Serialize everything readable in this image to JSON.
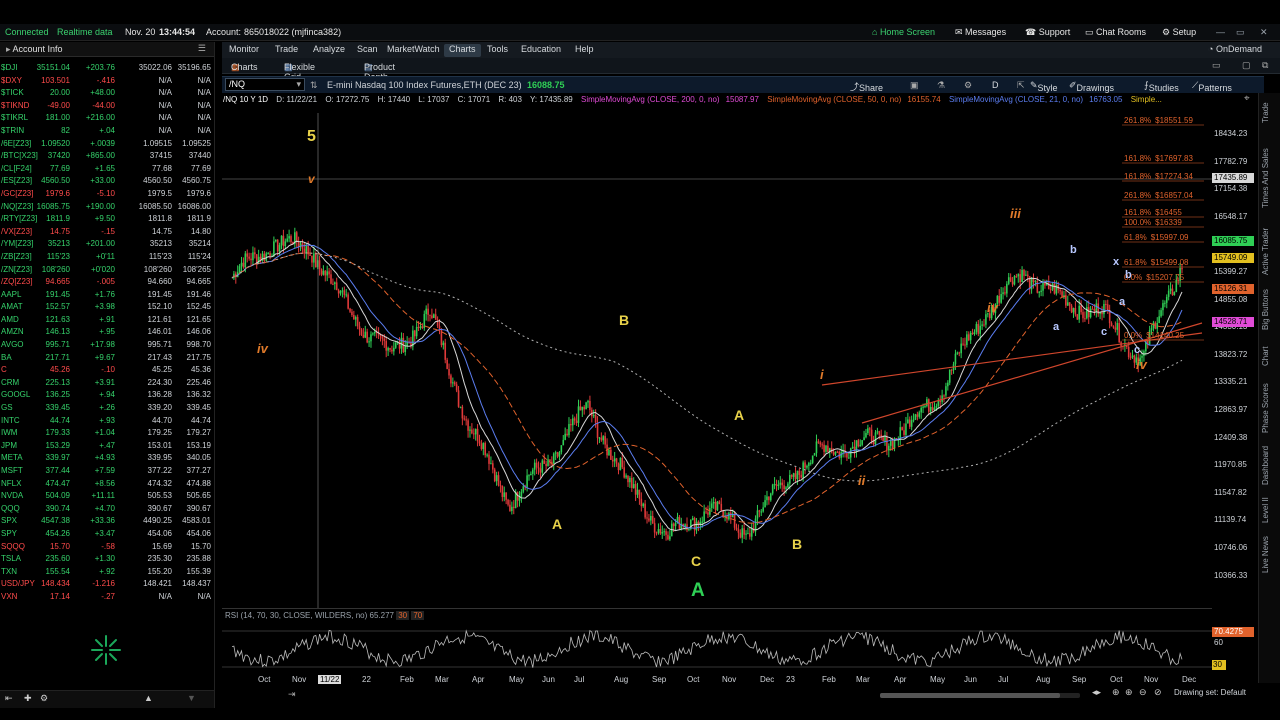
{
  "topbar": {
    "connection": "Connected",
    "data_mode": "Realtime data",
    "date": "Nov. 20",
    "time": "13:44:54",
    "account_label": "Account:",
    "account": "865018022 (mjfinca382)",
    "home": "Home Screen",
    "messages": "Messages",
    "support": "Support",
    "chat": "Chat Rooms",
    "setup": "Setup"
  },
  "sidebar": {
    "header": "Account Info",
    "watchlist": [
      {
        "sym": "$DJI",
        "last": "35151.04",
        "chg": "+203.76",
        "bid": "35022.06",
        "ask": "35196.65",
        "dir": "up"
      },
      {
        "sym": "$DXY",
        "last": "103.501",
        "chg": "-.416",
        "bid": "N/A",
        "ask": "N/A",
        "dir": "dn"
      },
      {
        "sym": "$TICK",
        "last": "20.00",
        "chg": "+48.00",
        "bid": "N/A",
        "ask": "N/A",
        "dir": "up"
      },
      {
        "sym": "$TIKND",
        "last": "-49.00",
        "chg": "-44.00",
        "bid": "N/A",
        "ask": "N/A",
        "dir": "dn"
      },
      {
        "sym": "$TIKRL",
        "last": "181.00",
        "chg": "+216.00",
        "bid": "N/A",
        "ask": "N/A",
        "dir": "up"
      },
      {
        "sym": "$TRIN",
        "last": "82",
        "chg": "+.04",
        "bid": "N/A",
        "ask": "N/A",
        "dir": "up"
      },
      {
        "sym": "/6E[Z23]",
        "last": "1.09520",
        "chg": "+.0039",
        "bid": "1.09515",
        "ask": "1.09525",
        "dir": "up"
      },
      {
        "sym": "/BTC[X23]",
        "last": "37420",
        "chg": "+865.00",
        "bid": "37415",
        "ask": "37440",
        "dir": "up"
      },
      {
        "sym": "/CL[F24]",
        "last": "77.69",
        "chg": "+1.65",
        "bid": "77.68",
        "ask": "77.69",
        "dir": "up"
      },
      {
        "sym": "/ES[Z23]",
        "last": "4560.50",
        "chg": "+33.00",
        "bid": "4560.50",
        "ask": "4560.75",
        "dir": "up"
      },
      {
        "sym": "/GC[Z23]",
        "last": "1979.6",
        "chg": "-5.10",
        "bid": "1979.5",
        "ask": "1979.6",
        "dir": "dn"
      },
      {
        "sym": "/NQ[Z23]",
        "last": "16085.75",
        "chg": "+190.00",
        "bid": "16085.50",
        "ask": "16086.00",
        "dir": "up"
      },
      {
        "sym": "/RTY[Z23]",
        "last": "1811.9",
        "chg": "+9.50",
        "bid": "1811.8",
        "ask": "1811.9",
        "dir": "up"
      },
      {
        "sym": "/VX[Z23]",
        "last": "14.75",
        "chg": "-.15",
        "bid": "14.75",
        "ask": "14.80",
        "dir": "dn"
      },
      {
        "sym": "/YM[Z23]",
        "last": "35213",
        "chg": "+201.00",
        "bid": "35213",
        "ask": "35214",
        "dir": "up"
      },
      {
        "sym": "/ZB[Z23]",
        "last": "115'23",
        "chg": "+0'11",
        "bid": "115'23",
        "ask": "115'24",
        "dir": "up"
      },
      {
        "sym": "/ZN[Z23]",
        "last": "108'260",
        "chg": "+0'020",
        "bid": "108'260",
        "ask": "108'265",
        "dir": "up"
      },
      {
        "sym": "/ZQ[Z23]",
        "last": "94.665",
        "chg": "-.005",
        "bid": "94.660",
        "ask": "94.665",
        "dir": "dn"
      },
      {
        "sym": "AAPL",
        "last": "191.45",
        "chg": "+1.76",
        "bid": "191.45",
        "ask": "191.46",
        "dir": "up"
      },
      {
        "sym": "AMAT",
        "last": "152.57",
        "chg": "+3.98",
        "bid": "152.10",
        "ask": "152.45",
        "dir": "up"
      },
      {
        "sym": "AMD",
        "last": "121.63",
        "chg": "+.91",
        "bid": "121.61",
        "ask": "121.65",
        "dir": "up"
      },
      {
        "sym": "AMZN",
        "last": "146.13",
        "chg": "+.95",
        "bid": "146.01",
        "ask": "146.06",
        "dir": "up"
      },
      {
        "sym": "AVGO",
        "last": "995.71",
        "chg": "+17.98",
        "bid": "995.71",
        "ask": "998.70",
        "dir": "up"
      },
      {
        "sym": "BA",
        "last": "217.71",
        "chg": "+9.67",
        "bid": "217.43",
        "ask": "217.75",
        "dir": "up"
      },
      {
        "sym": "C",
        "last": "45.26",
        "chg": "-.10",
        "bid": "45.25",
        "ask": "45.36",
        "dir": "dn"
      },
      {
        "sym": "CRM",
        "last": "225.13",
        "chg": "+3.91",
        "bid": "224.30",
        "ask": "225.46",
        "dir": "up"
      },
      {
        "sym": "GOOGL",
        "last": "136.25",
        "chg": "+.94",
        "bid": "136.28",
        "ask": "136.32",
        "dir": "up"
      },
      {
        "sym": "GS",
        "last": "339.45",
        "chg": "+.26",
        "bid": "339.20",
        "ask": "339.45",
        "dir": "up"
      },
      {
        "sym": "INTC",
        "last": "44.74",
        "chg": "+.93",
        "bid": "44.70",
        "ask": "44.74",
        "dir": "up"
      },
      {
        "sym": "IWM",
        "last": "179.33",
        "chg": "+1.04",
        "bid": "179.25",
        "ask": "179.27",
        "dir": "up"
      },
      {
        "sym": "JPM",
        "last": "153.29",
        "chg": "+.47",
        "bid": "153.01",
        "ask": "153.19",
        "dir": "up"
      },
      {
        "sym": "META",
        "last": "339.97",
        "chg": "+4.93",
        "bid": "339.95",
        "ask": "340.05",
        "dir": "up"
      },
      {
        "sym": "MSFT",
        "last": "377.44",
        "chg": "+7.59",
        "bid": "377.22",
        "ask": "377.27",
        "dir": "up"
      },
      {
        "sym": "NFLX",
        "last": "474.47",
        "chg": "+8.56",
        "bid": "474.32",
        "ask": "474.88",
        "dir": "up"
      },
      {
        "sym": "NVDA",
        "last": "504.09",
        "chg": "+11.11",
        "bid": "505.53",
        "ask": "505.65",
        "dir": "up"
      },
      {
        "sym": "QQQ",
        "last": "390.74",
        "chg": "+4.70",
        "bid": "390.67",
        "ask": "390.67",
        "dir": "up"
      },
      {
        "sym": "SPX",
        "last": "4547.38",
        "chg": "+33.36",
        "bid": "4490.25",
        "ask": "4583.01",
        "dir": "up"
      },
      {
        "sym": "SPY",
        "last": "454.26",
        "chg": "+3.47",
        "bid": "454.06",
        "ask": "454.06",
        "dir": "up"
      },
      {
        "sym": "SQQQ",
        "last": "15.70",
        "chg": "-.58",
        "bid": "15.69",
        "ask": "15.70",
        "dir": "dn"
      },
      {
        "sym": "TSLA",
        "last": "235.60",
        "chg": "+1.30",
        "bid": "235.30",
        "ask": "235.88",
        "dir": "up"
      },
      {
        "sym": "TXN",
        "last": "155.54",
        "chg": "+.92",
        "bid": "155.20",
        "ask": "155.39",
        "dir": "up"
      },
      {
        "sym": "USD/JPY",
        "last": "148.434",
        "chg": "-1.216",
        "bid": "148.421",
        "ask": "148.437",
        "dir": "dn"
      },
      {
        "sym": "VXN",
        "last": "17.14",
        "chg": "-.27",
        "bid": "N/A",
        "ask": "N/A",
        "dir": "dn"
      }
    ]
  },
  "menu": [
    "Monitor",
    "Trade",
    "Analyze",
    "Scan",
    "MarketWatch",
    "Charts",
    "Tools",
    "Education",
    "Help"
  ],
  "menu_active": "Charts",
  "ondemand": "OnDemand",
  "subtabs": {
    "charts": "Charts",
    "grid": "Flexible Grid",
    "depth": "Product Depth"
  },
  "toolbar": {
    "symbol": "/NQ",
    "description": "E-mini Nasdaq 100 Index Futures,ETH (DEC 23)",
    "price": "16088.75",
    "share": "Share",
    "period": "D",
    "style": "Style",
    "drawings": "Drawings",
    "studies": "Studies",
    "patterns": "Patterns"
  },
  "infobar": {
    "label": "/NQ 10 Y 1D",
    "d": "D: 11/22/21",
    "o": "O: 17272.75",
    "h": "H: 17440",
    "l": "L: 17037",
    "c": "C: 17071",
    "r": "R: 403",
    "y": "Y: 17435.89",
    "sma200": "SimpleMovingAvg (CLOSE, 200, 0, no)",
    "sma200v": "15087.97",
    "sma50": "SimpleMovingAvg (CLOSE, 50, 0, no)",
    "sma50v": "16155.74",
    "sma21": "SimpleMovingAvg (CLOSE, 21, 0, no)",
    "sma21v": "16763.05",
    "more": "Simple..."
  },
  "yaxis": [
    "18434.23",
    "17782.79",
    "17154.38",
    "16548.17",
    "15963.35",
    "15399.27",
    "14855.08",
    "14330.13",
    "13823.72",
    "13335.21",
    "12863.97",
    "12409.38",
    "11970.85",
    "11547.82",
    "11139.74",
    "10746.06",
    "10366.33"
  ],
  "ytags": [
    {
      "v": "17435.89",
      "c": "#d8d8d8"
    },
    {
      "v": "16085.75",
      "c": "#2fcf55"
    },
    {
      "v": "15749.09",
      "c": "#e3c020"
    },
    {
      "v": "15126.31",
      "c": "#e0622c"
    },
    {
      "v": "14528.71",
      "c": "#e04bd6"
    }
  ],
  "fib": [
    {
      "t": "261.8%",
      "v": "$18551.59"
    },
    {
      "t": "161.8%",
      "v": "$17697.83"
    },
    {
      "t": "161.8%",
      "v": "$17274.34"
    },
    {
      "t": "261.8%",
      "v": "$16857.04"
    },
    {
      "t": "161.8%",
      "v": "$16455"
    },
    {
      "t": "100.0%",
      "v": "$16339"
    },
    {
      "t": "61.8%",
      "v": "$15997.09"
    },
    {
      "t": "61.8%",
      "v": "$15499.08"
    },
    {
      "t": "0.0%",
      "v": "$15207.75"
    },
    {
      "t": "0.0%",
      "v": "$14140.25"
    }
  ],
  "waves": [
    {
      "t": "5",
      "c": "#e8d24a"
    },
    {
      "t": "v",
      "c": "#e07a2a"
    },
    {
      "t": "iv",
      "c": "#e07a2a"
    },
    {
      "t": "B",
      "c": "#e8d24a"
    },
    {
      "t": "A",
      "c": "#e8d24a"
    },
    {
      "t": "C",
      "c": "#e8d24a"
    },
    {
      "t": "A",
      "c": "#2fcf55"
    },
    {
      "t": "A",
      "c": "#e8d24a"
    },
    {
      "t": "B",
      "c": "#e8d24a"
    },
    {
      "t": "i",
      "c": "#e07a2a"
    },
    {
      "t": "ii",
      "c": "#e07a2a"
    },
    {
      "t": "iii",
      "c": "#e07a2a"
    },
    {
      "t": "iv",
      "c": "#e07a2a"
    },
    {
      "t": "iv",
      "c": "#e07a2a"
    },
    {
      "t": "a",
      "c": "#b8c8ff"
    },
    {
      "t": "b",
      "c": "#b8c8ff"
    },
    {
      "t": "c",
      "c": "#b8c8ff"
    },
    {
      "t": "x",
      "c": "#b8c8ff"
    },
    {
      "t": "b",
      "c": "#b8c8ff"
    },
    {
      "t": "a",
      "c": "#b8c8ff"
    },
    {
      "t": "c",
      "c": "#b8c8ff"
    }
  ],
  "rsi": {
    "label": "RSI (14, 70, 30, CLOSE, WILDERS, no)",
    "value": "65.277",
    "ob": "30",
    "os": "70",
    "tag": "70.4275",
    "l60": "60",
    "l30": "30"
  },
  "xaxis": [
    "Oct",
    "Nov",
    "11/22",
    "22",
    "Feb",
    "Mar",
    "Apr",
    "May",
    "Jun",
    "Jul",
    "Aug",
    "Sep",
    "Oct",
    "Nov",
    "Dec",
    "23",
    "Feb",
    "Mar",
    "Apr",
    "May",
    "Jun",
    "Jul",
    "Aug",
    "Sep",
    "Oct",
    "Nov",
    "Dec"
  ],
  "right_tabs": [
    "Trade",
    "Times And Sales",
    "Active Trader",
    "Big Buttons",
    "Chart",
    "Phase Scores",
    "Dashboard",
    "Level II",
    "Live News"
  ],
  "status": {
    "drawing_set": "Drawing set: Default"
  },
  "chart_data": {
    "type": "line",
    "x": [
      "Oct",
      "Nov",
      "22",
      "Feb",
      "Mar",
      "Apr",
      "May",
      "Jun",
      "Jul",
      "Aug",
      "Sep",
      "Oct",
      "Nov",
      "Dec",
      "23",
      "Feb",
      "Mar",
      "Apr",
      "May",
      "Jun",
      "Jul",
      "Aug",
      "Sep",
      "Oct",
      "Nov"
    ],
    "series": [
      {
        "values": [
          15800,
          16400,
          16300,
          15200,
          14500,
          15200,
          13300,
          12000,
          12700,
          13600,
          12300,
          11400,
          11900,
          11500,
          12400,
          12900,
          13000,
          13200,
          14000,
          15200,
          15900,
          15400,
          15200,
          14400,
          16085
        ]
      }
    ],
    "ylim": [
      10366,
      18434
    ]
  }
}
